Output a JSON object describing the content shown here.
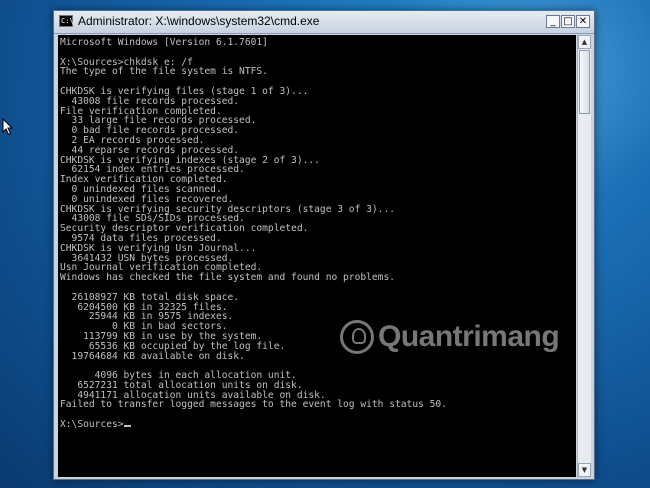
{
  "window": {
    "title": "Administrator: X:\\windows\\system32\\cmd.exe",
    "icon_label": "C:\\",
    "minimize_glyph": "_",
    "maximize_glyph": "□",
    "close_glyph": "✕"
  },
  "console": {
    "lines": [
      "Microsoft Windows [Version 6.1.7601]",
      "",
      "X:\\Sources>chkdsk e: /f",
      "The type of the file system is NTFS.",
      "",
      "CHKDSK is verifying files (stage 1 of 3)...",
      "  43008 file records processed.",
      "File verification completed.",
      "  33 large file records processed.",
      "  0 bad file records processed.",
      "  2 EA records processed.",
      "  44 reparse records processed.",
      "CHKDSK is verifying indexes (stage 2 of 3)...",
      "  62154 index entries processed.",
      "Index verification completed.",
      "  0 unindexed files scanned.",
      "  0 unindexed files recovered.",
      "CHKDSK is verifying security descriptors (stage 3 of 3)...",
      "  43008 file SDs/SIDs processed.",
      "Security descriptor verification completed.",
      "  9574 data files processed.",
      "CHKDSK is verifying Usn Journal...",
      "  3641432 USN bytes processed.",
      "Usn Journal verification completed.",
      "Windows has checked the file system and found no problems.",
      "",
      "  26108927 KB total disk space.",
      "   6204500 KB in 32325 files.",
      "     25944 KB in 9575 indexes.",
      "         0 KB in bad sectors.",
      "    113799 KB in use by the system.",
      "     65536 KB occupied by the log file.",
      "  19764684 KB available on disk.",
      "",
      "      4096 bytes in each allocation unit.",
      "   6527231 total allocation units on disk.",
      "   4941171 allocation units available on disk.",
      "Failed to transfer logged messages to the event log with status 50.",
      ""
    ],
    "prompt": "X:\\Sources>"
  },
  "scrollbar": {
    "up_glyph": "▲",
    "down_glyph": "▼"
  },
  "watermark": {
    "text": "Quantrimang"
  },
  "colors": {
    "console_bg": "#000000",
    "console_fg": "#c0c0c0",
    "desktop_bg": "#1a6db3"
  }
}
